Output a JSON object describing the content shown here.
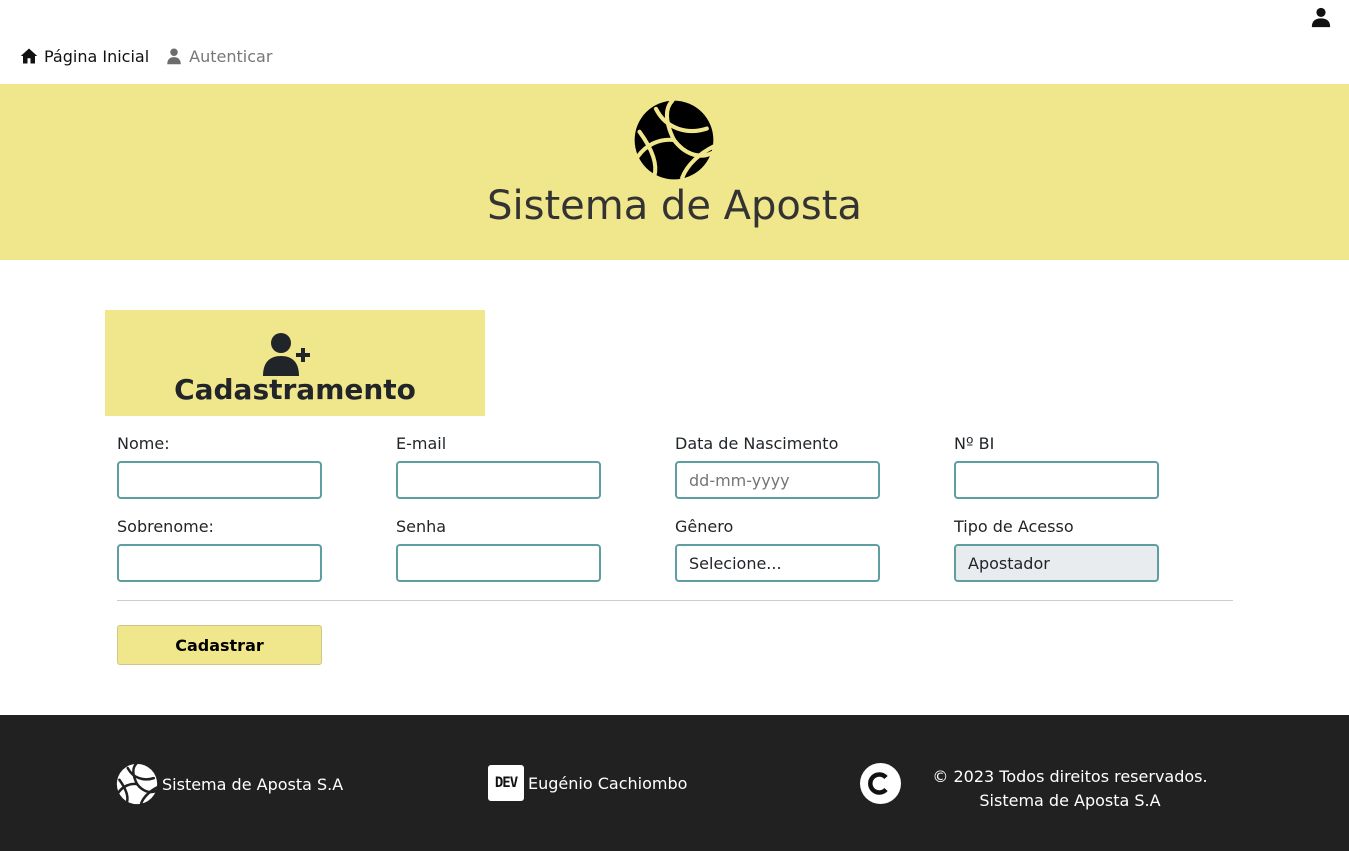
{
  "topbar": {
    "nav": [
      {
        "label": "Página Inicial",
        "icon": "home-icon"
      },
      {
        "label": "Autenticar",
        "icon": "user-icon"
      }
    ],
    "account_icon": "user-icon"
  },
  "banner": {
    "title": "Sistema de Aposta",
    "logo_icon": "volleyball-icon",
    "background": "#f0e68c"
  },
  "form": {
    "header": {
      "title": "Cadastramento",
      "icon": "user-plus-icon"
    },
    "fields": {
      "nome": {
        "label": "Nome:",
        "value": ""
      },
      "email": {
        "label": "E-mail",
        "value": ""
      },
      "nascimento": {
        "label": "Data de Nascimento",
        "placeholder": "dd-mm-yyyy",
        "value": ""
      },
      "bi": {
        "label": "Nº BI",
        "value": ""
      },
      "sobrenome": {
        "label": "Sobrenome:",
        "value": ""
      },
      "senha": {
        "label": "Senha",
        "value": ""
      },
      "genero": {
        "label": "Gênero",
        "value": "Selecione..."
      },
      "tipo_acesso": {
        "label": "Tipo de Acesso",
        "value": "Apostador"
      }
    },
    "submit_label": "Cadastrar",
    "accent_border": "#5f9ea0"
  },
  "footer": {
    "company": "Sistema de Aposta S.A",
    "dev_badge": "DEV",
    "dev_name": "Eugénio Cachiombo",
    "copyright_line1": "© 2023 Todos direitos reservados.",
    "copyright_line2": "Sistema de Aposta S.A",
    "background": "#212121"
  }
}
